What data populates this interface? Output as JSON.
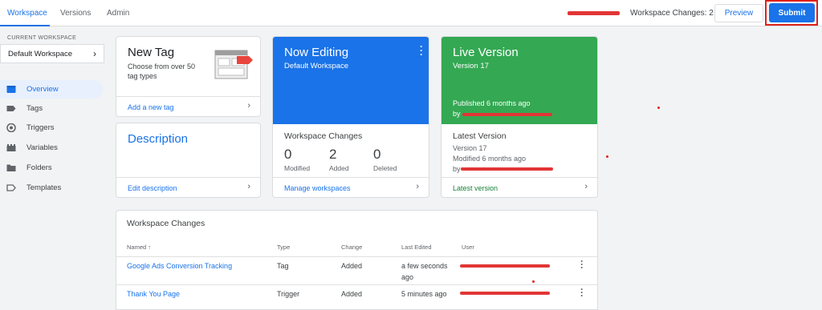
{
  "topbar": {
    "tabs": [
      "Workspace",
      "Versions",
      "Admin"
    ],
    "workspace_changes": "Workspace Changes: 2",
    "preview_label": "Preview",
    "submit_label": "Submit"
  },
  "sidebar": {
    "current_workspace_label": "CURRENT WORKSPACE",
    "workspace_name": "Default Workspace",
    "items": [
      {
        "label": "Overview",
        "icon": "overview-icon"
      },
      {
        "label": "Tags",
        "icon": "tag-icon"
      },
      {
        "label": "Triggers",
        "icon": "trigger-icon"
      },
      {
        "label": "Variables",
        "icon": "variables-icon"
      },
      {
        "label": "Folders",
        "icon": "folder-icon"
      },
      {
        "label": "Templates",
        "icon": "template-icon"
      }
    ]
  },
  "new_tag": {
    "title": "New Tag",
    "subtitle": "Choose from over 50 tag types",
    "link": "Add a new tag"
  },
  "description": {
    "title": "Description",
    "link": "Edit description"
  },
  "now_editing": {
    "title": "Now Editing",
    "workspace": "Default Workspace",
    "section_title": "Workspace Changes",
    "stats": [
      {
        "value": "0",
        "label": "Modified"
      },
      {
        "value": "2",
        "label": "Added"
      },
      {
        "value": "0",
        "label": "Deleted"
      }
    ],
    "link": "Manage workspaces"
  },
  "live_version": {
    "title": "Live Version",
    "version": "Version 17",
    "published": "Published 6 months ago",
    "by": "by",
    "latest_title": "Latest Version",
    "latest_version": "Version 17",
    "latest_modified": "Modified 6 months ago",
    "latest_by": "by",
    "link": "Latest version"
  },
  "changes_table": {
    "title": "Workspace Changes",
    "headers": [
      "Named",
      "Type",
      "Change",
      "Last Edited",
      "User"
    ],
    "sort_arrow": "↑",
    "rows": [
      {
        "name": "Google Ads Conversion Tracking",
        "type": "Tag",
        "change": "Added",
        "edited_line1": "a few seconds",
        "edited_line2": "ago"
      },
      {
        "name": "Thank You Page",
        "type": "Trigger",
        "change": "Added",
        "edited_line1": "5 minutes ago",
        "edited_line2": ""
      }
    ]
  },
  "colors": {
    "accent": "#1a73e8",
    "live": "#34a853",
    "annotation": "#e0201a"
  }
}
